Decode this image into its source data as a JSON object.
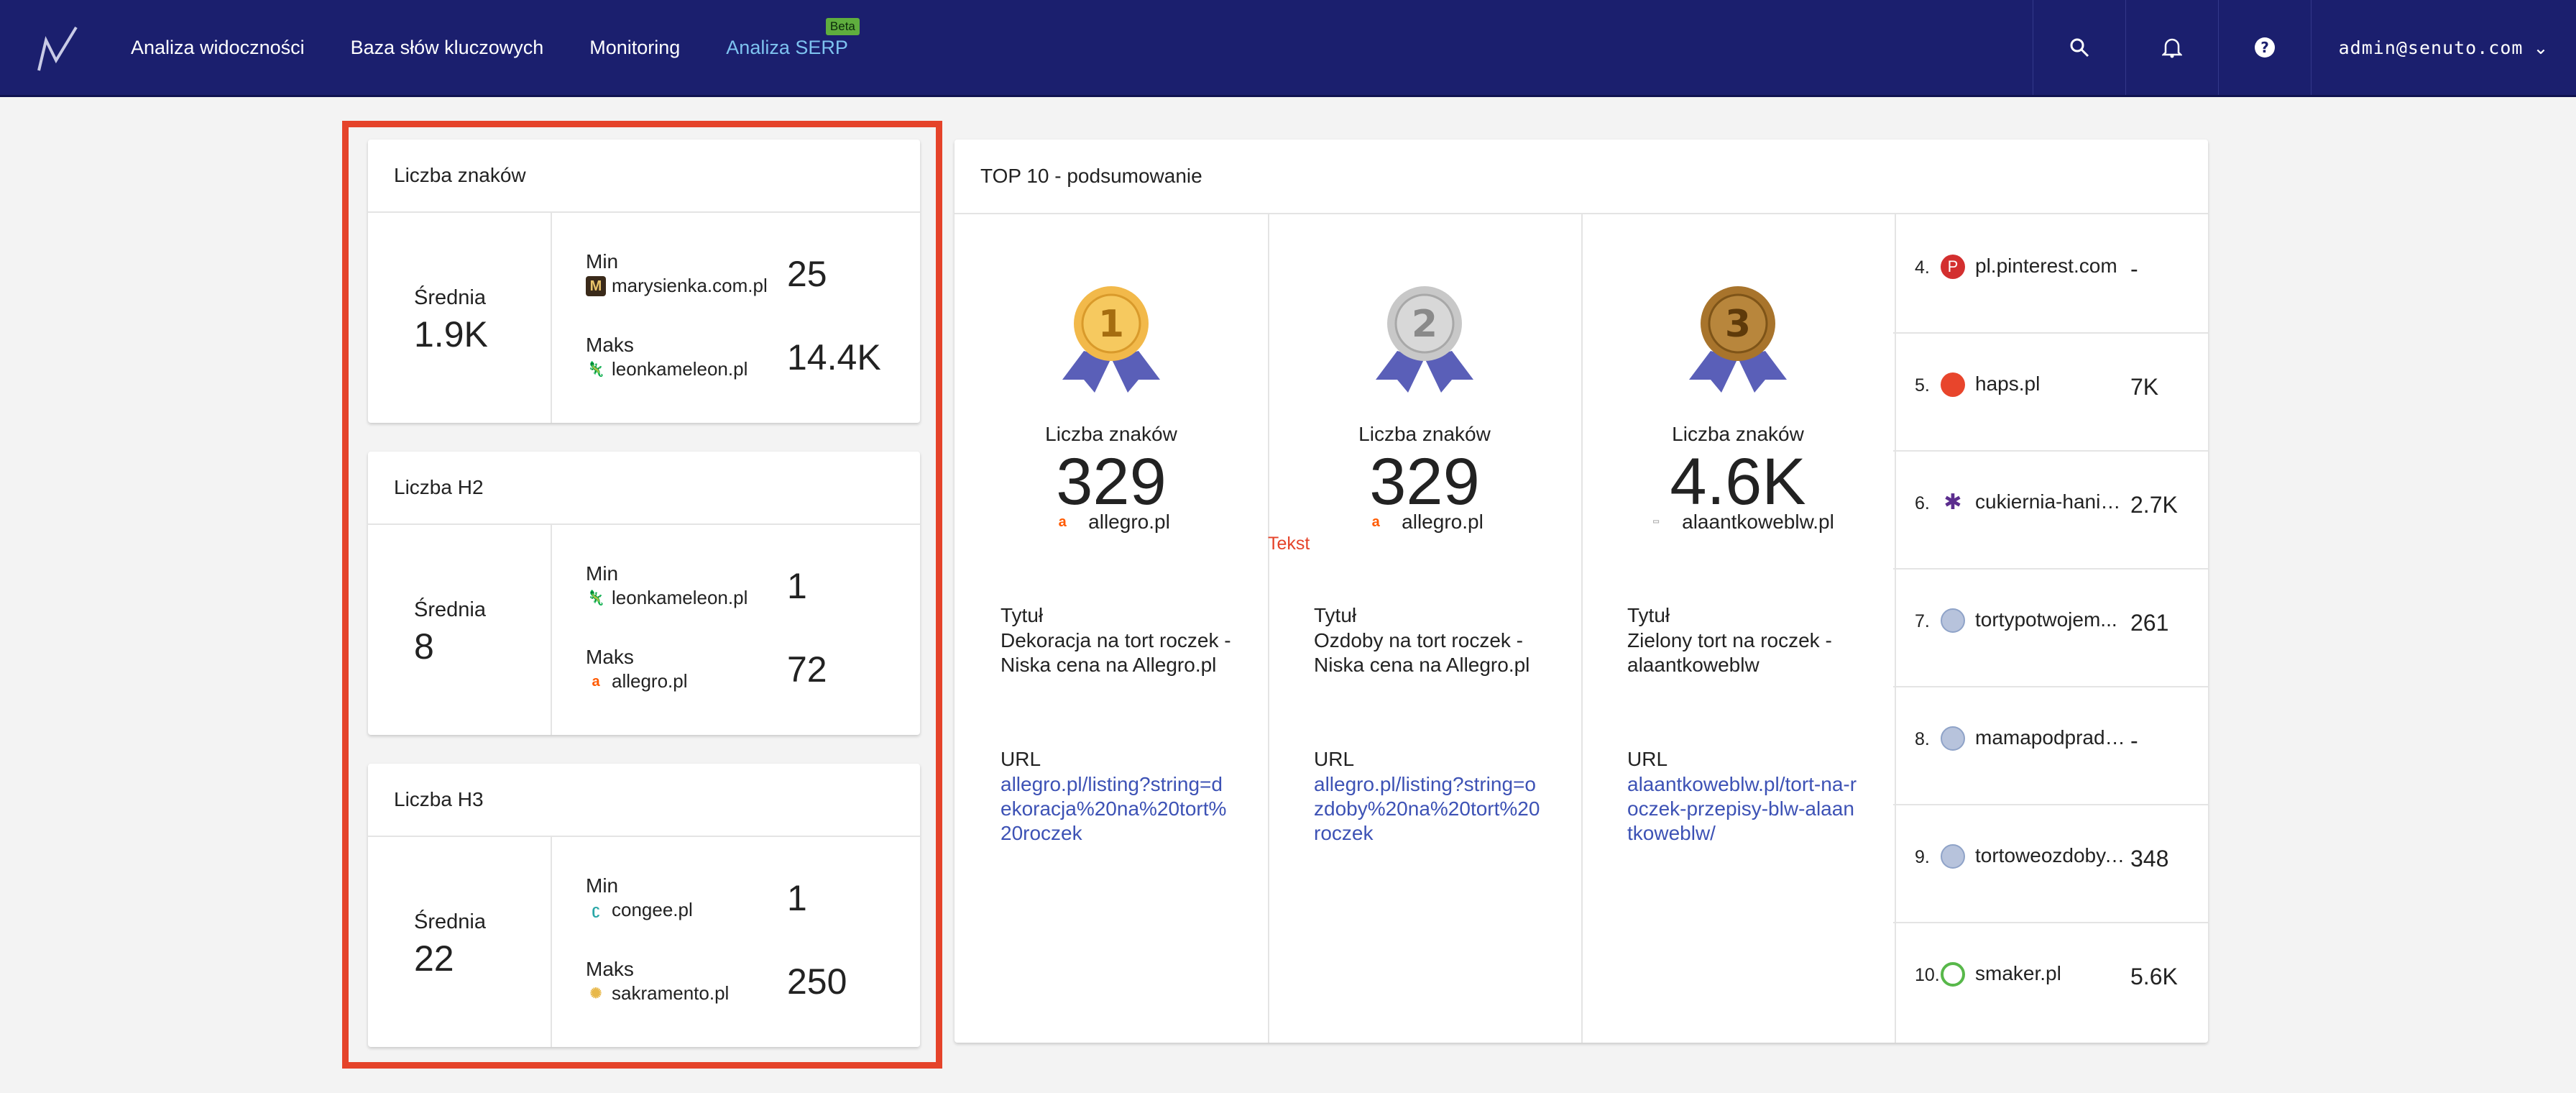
{
  "nav": {
    "items": [
      "Analiza widoczności",
      "Baza słów kluczowych",
      "Monitoring",
      "Analiza SERP"
    ],
    "beta": "Beta",
    "user": "admin@senuto.com"
  },
  "metrics": [
    {
      "title": "Liczba znaków",
      "avg_label": "Średnia",
      "avg": "1.9K",
      "min_label": "Min",
      "min_site": "marysienka.com.pl",
      "min": "25",
      "max_label": "Maks",
      "max_site": "leonkameleon.pl",
      "max": "14.4K"
    },
    {
      "title": "Liczba H2",
      "avg_label": "Średnia",
      "avg": "8",
      "min_label": "Min",
      "min_site": "leonkameleon.pl",
      "min": "1",
      "max_label": "Maks",
      "max_site": "allegro.pl",
      "max": "72"
    },
    {
      "title": "Liczba H3",
      "avg_label": "Średnia",
      "avg": "22",
      "min_label": "Min",
      "min_site": "congee.pl",
      "min": "1",
      "max_label": "Maks",
      "max_site": "sakramento.pl",
      "max": "250"
    }
  ],
  "top10": {
    "title": "TOP 10 - podsumowanie",
    "podium": [
      {
        "place": "1",
        "label": "Liczba znaków",
        "value": "329",
        "site": "allegro.pl",
        "title_label": "Tytuł",
        "title": "Dekoracja na tort roczek - Niska cena na Allegro.pl",
        "url_label": "URL",
        "url": "allegro.pl/listing?string=dekoracja%20na%20tort%20roczek"
      },
      {
        "place": "2",
        "label": "Liczba znaków",
        "value": "329",
        "site": "allegro.pl",
        "title_label": "Tytuł",
        "title": "Ozdoby na tort roczek - Niska cena na Allegro.pl",
        "url_label": "URL",
        "url": "allegro.pl/listing?string=ozdoby%20na%20tort%20roczek"
      },
      {
        "place": "3",
        "label": "Liczba znaków",
        "value": "4.6K",
        "site": "alaantkoweblw.pl",
        "title_label": "Tytuł",
        "title": "Zielony tort na roczek - alaantkoweblw",
        "url_label": "URL",
        "url": "alaantkoweblw.pl/tort-na-roczek-przepisy-blw-alaantkoweblw/"
      }
    ],
    "ranks": [
      {
        "num": "4.",
        "site": "pl.pinterest.com",
        "value": "-",
        "color": "#d32f2f",
        "glyph": "P"
      },
      {
        "num": "5.",
        "site": "haps.pl",
        "value": "7K",
        "color": "#e8452c",
        "glyph": "●"
      },
      {
        "num": "6.",
        "site": "cukiernia-hania...",
        "value": "2.7K",
        "color": "#5b2d8e",
        "glyph": "✱"
      },
      {
        "num": "7.",
        "site": "tortypotwojem...",
        "value": "261",
        "color": "#8fa3c8",
        "glyph": "◍"
      },
      {
        "num": "8.",
        "site": "mamapodprad.pl",
        "value": "-",
        "color": "#8fa3c8",
        "glyph": "◍"
      },
      {
        "num": "9.",
        "site": "tortoweozdoby....",
        "value": "348",
        "color": "#8fa3c8",
        "glyph": "◍"
      },
      {
        "num": "10.",
        "site": "smaker.pl",
        "value": "5.6K",
        "color": "#58b84a",
        "glyph": "◔"
      }
    ]
  },
  "annotation": "Tekst",
  "colors": {
    "nav_bg": "#1b1f6e",
    "highlight": "#e5432a",
    "link": "#3d52b5",
    "gold": "#f2b94a",
    "silver": "#c8c8c8",
    "bronze": "#a8742c",
    "ribbon": "#5a5fb8"
  }
}
